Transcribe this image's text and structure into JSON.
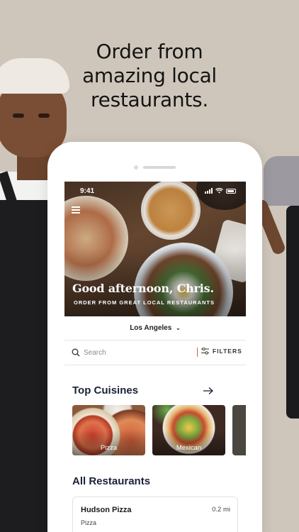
{
  "headline": [
    "Order from",
    "amazing local",
    "restaurants."
  ],
  "status_bar": {
    "time": "9:41"
  },
  "hero": {
    "greeting": "Good afternoon, Chris.",
    "subtitle": "ORDER FROM GREAT LOCAL RESTAURANTS"
  },
  "location": {
    "label": "Los Angeles"
  },
  "search": {
    "placeholder": "Search",
    "filters_label": "FILTERS"
  },
  "top_cuisines": {
    "title": "Top Cuisines",
    "items": [
      {
        "label": "Pizza"
      },
      {
        "label": "Mexican"
      },
      {
        "label": ""
      }
    ]
  },
  "all_restaurants": {
    "title": "All Restaurants",
    "items": [
      {
        "name": "Hudson Pizza",
        "distance": "0.2 mi",
        "category": "Pizza"
      }
    ]
  },
  "colors": {
    "background": "#cfc6bb",
    "accent": "#d9603f",
    "heading_navy": "#1a2238"
  }
}
